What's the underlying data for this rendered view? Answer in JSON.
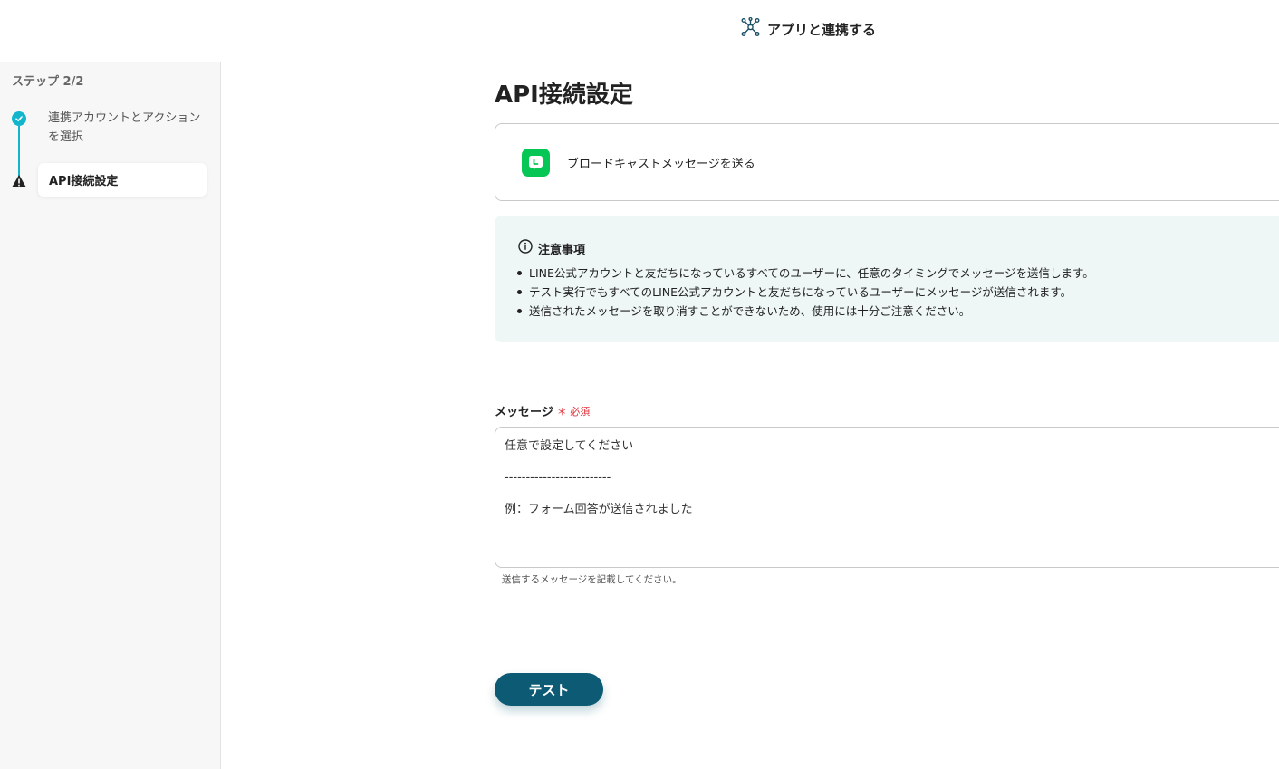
{
  "header": {
    "title": "アプリと連携する",
    "icon": "network-icon"
  },
  "sidebar": {
    "step_count": "ステップ 2/2",
    "steps": [
      {
        "label": "連携アカウントとアクションを選択",
        "status": "complete"
      },
      {
        "label": "API接続設定",
        "status": "warning"
      }
    ]
  },
  "main": {
    "title": "API接続設定",
    "action": {
      "label": "ブロードキャストメッセージを送る",
      "app_icon": "line-app-icon",
      "brand_color": "#06C755"
    },
    "notice": {
      "title": "注意事項",
      "items": [
        "LINE公式アカウントと友だちになっているすべてのユーザーに、任意のタイミングでメッセージを送信します。",
        "テスト実行でもすべてのLINE公式アカウントと友だちになっているユーザーにメッセージが送信されます。",
        "送信されたメッセージを取り消すことができないため、使用には十分ご注意ください。"
      ]
    },
    "message_field": {
      "label": "メッセージ",
      "required_label": "＊ 必須",
      "lines": [
        "任意で設定してください",
        "-------------------------",
        "例：フォーム回答が送信されました"
      ],
      "hint": "送信するメッセージを記載してください。"
    },
    "test_button": "テスト"
  },
  "colors": {
    "accent": "#12B5CB",
    "primary_button": "#0C5A73",
    "required": "#E0313B",
    "notice_bg": "#EEF6F6"
  }
}
